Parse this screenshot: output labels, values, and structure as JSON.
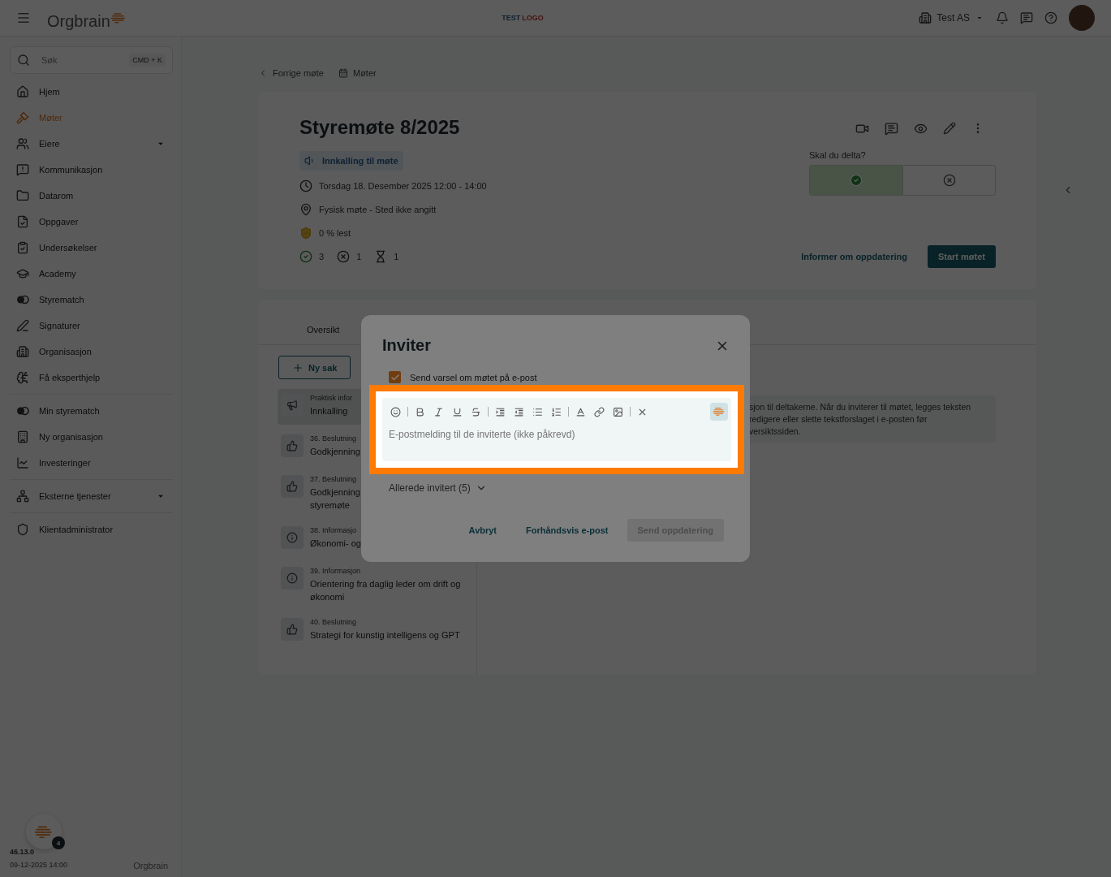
{
  "topbar": {
    "logo_text": "Orgbrain",
    "center_logo": [
      "TEST",
      "LOGO"
    ],
    "org": "Test AS"
  },
  "sidebar": {
    "search": {
      "placeholder": "Søk",
      "shortcut": "CMD + K"
    },
    "groups": [
      [
        {
          "label": "Hjem",
          "selected": false
        },
        {
          "label": "Møter",
          "selected": true
        },
        {
          "label": "Eiere",
          "selected": false,
          "expandable": true
        },
        {
          "label": "Kommunikasjon",
          "selected": false
        },
        {
          "label": "Datarom",
          "selected": false
        },
        {
          "label": "Oppgaver",
          "selected": false
        },
        {
          "label": "Undersøkelser",
          "selected": false
        },
        {
          "label": "Academy",
          "selected": false
        },
        {
          "label": "Styrematch",
          "selected": false
        },
        {
          "label": "Signaturer",
          "selected": false
        },
        {
          "label": "Organisasjon",
          "selected": false
        },
        {
          "label": "Få eksperthjelp",
          "selected": false
        }
      ],
      [
        {
          "label": "Min styrematch",
          "selected": false
        },
        {
          "label": "Ny organisasjon",
          "selected": false
        },
        {
          "label": "Investeringer",
          "selected": false
        }
      ],
      [
        {
          "label": "Eksterne tjenester",
          "selected": false,
          "expandable": true
        }
      ],
      [
        {
          "label": "Klientadministrator",
          "selected": false
        }
      ]
    ],
    "badge": "4",
    "version": "46.13.0",
    "date": "09-12-2025 14:00",
    "footer_logo": "Orgbrain"
  },
  "breadcrumb": {
    "back": "Forrige møte",
    "meetings": "Møter"
  },
  "meeting": {
    "title": "Styremøte 8/2025",
    "status": "Innkalling til møte",
    "time": "Torsdag 18. Desember 2025 12:00 - 14:00",
    "place": "Fysisk møte - Sted ikke angitt",
    "read": "0 % lest",
    "counts": [
      "3",
      "1",
      "1"
    ],
    "attend": {
      "question": "Skal du delta?",
      "yes_selected": true,
      "no_selected": false
    },
    "inform": "Informer om oppdatering",
    "start": "Start møtet"
  },
  "tabs": [
    {
      "label": "Oversikt",
      "selected": false
    }
  ],
  "new_item": "Ny sak",
  "agenda": [
    {
      "kind": "practical",
      "type": "Praktisk infor",
      "title": "Innkalling",
      "selected": true
    },
    {
      "kind": "decision",
      "type": "36. Beslutning",
      "title": "Godkjenning",
      "selected": false
    },
    {
      "kind": "decision",
      "type": "37. Beslutning",
      "title": "Godkjenning\nstyremøte",
      "selected": false
    },
    {
      "kind": "info",
      "type": "38. Informasjo",
      "title": "Økonomi- og",
      "selected": false
    },
    {
      "kind": "info",
      "type": "39. Informasjon",
      "title": "Orientering fra daglig leder om drift og økonomi",
      "selected": false
    },
    {
      "kind": "decision",
      "type": "40. Beslutning",
      "title": "Strategi for kunstig intelligens og GPT",
      "selected": false
    }
  ],
  "info_lines": [
    "sjon til deltakerne. Når du inviterer til møtet, legges teksten",
    "redigere eller slette tekstforslaget i e-posten før",
    "versiktssiden."
  ],
  "dialog": {
    "title": "Inviter",
    "notify": {
      "label": "Send varsel om møtet på e-post",
      "checked": true
    },
    "message": {
      "placeholder": "E-postmelding til de inviterte (ikke påkrevd)"
    },
    "invited": "Allerede invitert (5)",
    "buttons": [
      {
        "label": "Avbryt",
        "disabled": false,
        "kind": "text"
      },
      {
        "label": "Forhåndsvis e-post",
        "disabled": false,
        "kind": "text"
      },
      {
        "label": "Send oppdatering",
        "disabled": true,
        "kind": "filled"
      }
    ]
  }
}
